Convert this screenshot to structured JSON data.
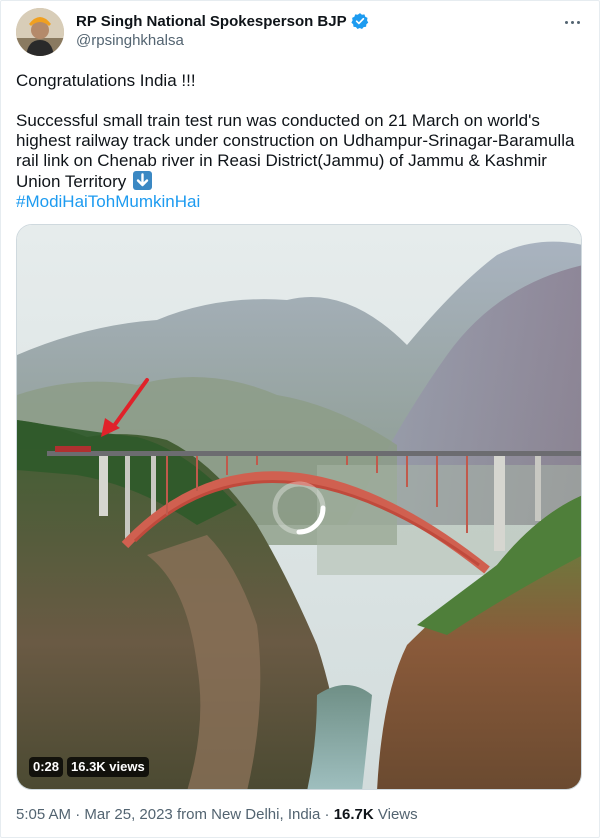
{
  "author": {
    "name": "RP Singh National Spokesperson BJP",
    "handle": "@rpsinghkhalsa",
    "verified_color": "#1d9bf0"
  },
  "tweet": {
    "line1": "Congratulations India !!!",
    "body": "Successful small train test run was conducted on 21 March on world's highest railway track under construction on Udhampur-Srinagar-Baramulla rail link on Chenab river in Reasi District(Jammu) of Jammu & Kashmir Union Territory",
    "emoji": "down-arrow-emoji",
    "hashtag": "#ModiHaiTohMumkinHai"
  },
  "video": {
    "duration": "0:28",
    "views": "16.3K views",
    "state": "loading-spinner"
  },
  "footer": {
    "time": "5:05 AM",
    "separator": "·",
    "date": "Mar 25, 2023",
    "source": "from New Delhi, India",
    "views_count": "16.7K",
    "views_label": "Views"
  },
  "colors": {
    "accent": "#1d9bf0",
    "text": "#0f1419",
    "muted": "#536471"
  }
}
